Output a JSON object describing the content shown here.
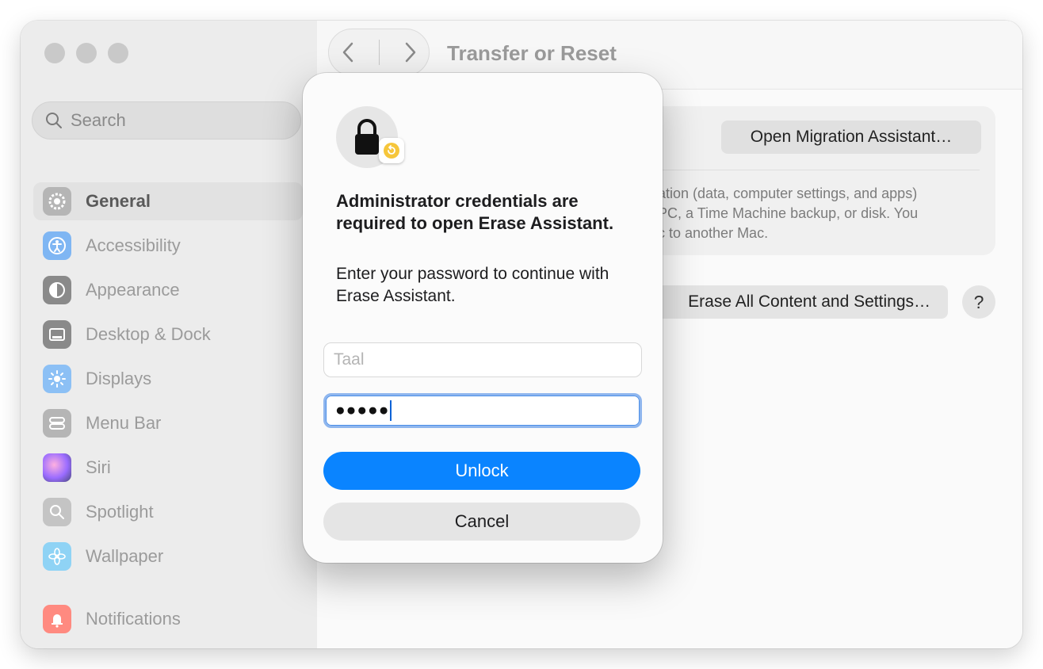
{
  "window": {
    "traffic_lights": [
      "close",
      "minimize",
      "zoom"
    ]
  },
  "sidebar": {
    "search_placeholder": "Search",
    "items": [
      {
        "label": "General",
        "icon": "gear-icon",
        "selected": true,
        "color": "#8e8e93"
      },
      {
        "label": "Accessibility",
        "icon": "accessibility-icon",
        "selected": false,
        "color": "#0a7aff"
      },
      {
        "label": "Appearance",
        "icon": "appearance-icon",
        "selected": false,
        "color": "#1c1c1e"
      },
      {
        "label": "Desktop & Dock",
        "icon": "dock-icon",
        "selected": false,
        "color": "#1c1c1e"
      },
      {
        "label": "Displays",
        "icon": "sun-icon",
        "selected": false,
        "color": "#2f8bff"
      },
      {
        "label": "Menu Bar",
        "icon": "menubar-icon",
        "selected": false,
        "color": "#8e8e93"
      },
      {
        "label": "Siri",
        "icon": "siri-icon",
        "selected": false,
        "color": "#a05cff"
      },
      {
        "label": "Spotlight",
        "icon": "magnifier-icon",
        "selected": false,
        "color": "#8e8e93"
      },
      {
        "label": "Wallpaper",
        "icon": "flower-icon",
        "selected": false,
        "color": "#30b0f0"
      },
      {
        "label": "Notifications",
        "icon": "bell-icon",
        "selected": false,
        "color": "#ff3b30"
      }
    ]
  },
  "main": {
    "page_title": "Transfer or Reset",
    "migration_button": "Open Migration Assistant…",
    "description_lines": [
      "ation (data, computer settings, and apps)",
      "PC, a Time Machine backup, or disk. You",
      "c to another Mac."
    ],
    "erase_button": "Erase All Content and Settings…",
    "help_button": "?"
  },
  "dialog": {
    "heading": "Administrator credentials are required to open Erase Assistant.",
    "message": "Enter your password to continue with Erase Assistant.",
    "username_placeholder": "Taal",
    "password_mask": "●●●●●",
    "unlock_label": "Unlock",
    "cancel_label": "Cancel",
    "accent_color": "#0a84ff"
  }
}
